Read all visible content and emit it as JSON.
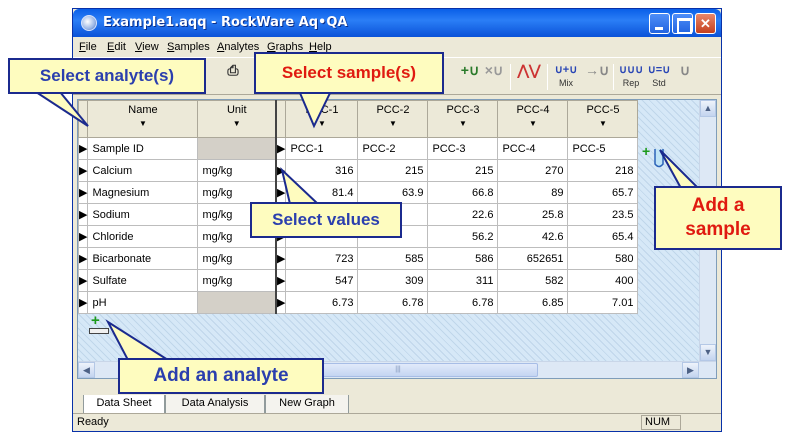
{
  "window": {
    "title": "Example1.aqq - RockWare Aq•QA"
  },
  "menu": [
    "File",
    "Edit",
    "View",
    "Samples",
    "Analytes",
    "Graphs",
    "Help"
  ],
  "toolbar": {
    "mix_label": "Mix",
    "rep_label": "Rep",
    "std_label": "Std"
  },
  "grid": {
    "header": {
      "name": "Name",
      "unit": "Unit"
    },
    "samples": [
      "PCC-1",
      "PCC-2",
      "PCC-3",
      "PCC-4",
      "PCC-5"
    ],
    "rows": [
      {
        "name": "Sample ID",
        "unit": "",
        "values": [
          "PCC-1",
          "PCC-2",
          "PCC-3",
          "PCC-4",
          "PCC-5"
        ]
      },
      {
        "name": "Calcium",
        "unit": "mg/kg",
        "values": [
          "316",
          "215",
          "215",
          "270",
          "218"
        ]
      },
      {
        "name": "Magnesium",
        "unit": "mg/kg",
        "values": [
          "81.4",
          "63.9",
          "66.8",
          "89",
          "65.7"
        ]
      },
      {
        "name": "Sodium",
        "unit": "mg/kg",
        "values": [
          "",
          "",
          "22.6",
          "25.8",
          "23.5"
        ]
      },
      {
        "name": "Chloride",
        "unit": "mg/kg",
        "values": [
          "",
          "",
          "56.2",
          "42.6",
          "65.4"
        ]
      },
      {
        "name": "Bicarbonate",
        "unit": "mg/kg",
        "values": [
          "723",
          "585",
          "586",
          "652651",
          "580"
        ]
      },
      {
        "name": "Sulfate",
        "unit": "mg/kg",
        "values": [
          "547",
          "309",
          "311",
          "582",
          "400"
        ]
      },
      {
        "name": "pH",
        "unit": "",
        "values": [
          "6.73",
          "6.78",
          "6.78",
          "6.85",
          "7.01"
        ]
      }
    ]
  },
  "tabs": [
    "Data Sheet",
    "Data Analysis",
    "New Graph"
  ],
  "status": {
    "text": "Ready",
    "num": "NUM"
  },
  "callouts": {
    "select_analytes": "Select analyte(s)",
    "select_samples": "Select sample(s)",
    "select_values": "Select values",
    "add_sample_1": "Add a",
    "add_sample_2": "sample",
    "add_analyte": "Add an analyte"
  },
  "colors": {
    "callout_bg": "#fefcbf",
    "callout_border": "#1b2a8e",
    "callout_text_blue": "#2b3fae",
    "callout_text_red": "#e01a10",
    "titlebar": "#0a5fe8"
  }
}
